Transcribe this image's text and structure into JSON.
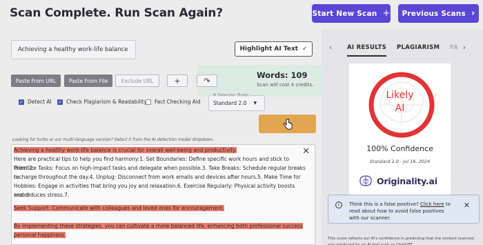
{
  "header": {
    "title": "Scan Complete. Run Scan Again?",
    "new_scan": "Start New Scan",
    "new_scan_icon": "+",
    "previous_scans": "Previous Scans",
    "previous_scans_icon": "›"
  },
  "form": {
    "title_value": "Achieving a healthy work-life balance",
    "highlight_label": "Highlight AI Text",
    "highlight_icon": "✓",
    "paste_url": "Paste From URL",
    "paste_file": "Paste From File",
    "exclude_url_placeholder": "Exclude URL",
    "add_icon": "+",
    "share_icon": "↷",
    "words": "Words: 109",
    "credits": "Scan will cost 4 credits.",
    "detect_ai": "Detect AI",
    "check_plagiarism": "Check Plagiarism & Readability",
    "fact_checking": "Fact Checking Aid",
    "model_label": "AI Detection Model",
    "model_value": "Standard 2.0",
    "note": "Looking for turbo or our multi-language version? Select it from the AI detection model dropdown."
  },
  "editor": {
    "p1": "Achieving a healthy work-life balance is crucial for overall well-being and productivity.",
    "p2a": " Here are practical tips to help you find harmony:1. Set Boundaries: Define specific work hours and stick to them.2.",
    "p2b": "Prioritize Tasks: Focus on high-impact tasks and delegate when possible.3. Take Breaks: Schedule regular breaks to",
    "p2c": "recharge throughout the day.4. Unplug: Disconnect from work emails and devices after hours.5. Make Time for",
    "p2d": "Hobbies: Engage in activities that bring you joy and relaxation.6. Exercise Regularly: Physical activity boosts mood",
    "p2e": "and reduces stress.7.",
    "p3": " Seek Support: Communicate with colleagues and loved ones for encouragement.",
    "p4a": "By implementing these strategies, you can cultivate a more balanced life, enhancing both professional success and",
    "p4b": "personal happiness.",
    "close": "✕"
  },
  "results": {
    "prev_arrow": "‹",
    "next_arrow": "›",
    "tab_ai": "AI RESULTS",
    "tab_plagiarism": "PLAGIARISM",
    "tab_more": "FA",
    "verdict_line1": "Likely",
    "verdict_line2": "AI",
    "confidence": "100% Confidence",
    "standard": "Standard 2.0 - Jul 16, 2024",
    "brand": "Originality.ai",
    "confidence_fraction": 1.0,
    "alert_text_a": "Think this is a false positive? ",
    "alert_link": "Click here",
    "alert_text_b": " to read about how to avoid false positives with our scanner.",
    "alert_info_icon": "i",
    "alert_close": "✕",
    "footnote": "This score reflects our AI's confidence in predicting that the content scanned was produced by an AI tool such as ChatGPT"
  },
  "colors": {
    "accent": "#5b46d6",
    "highlight": "#ec7c6c",
    "ai_red": "#e23434",
    "scan_button": "#e2a650"
  }
}
